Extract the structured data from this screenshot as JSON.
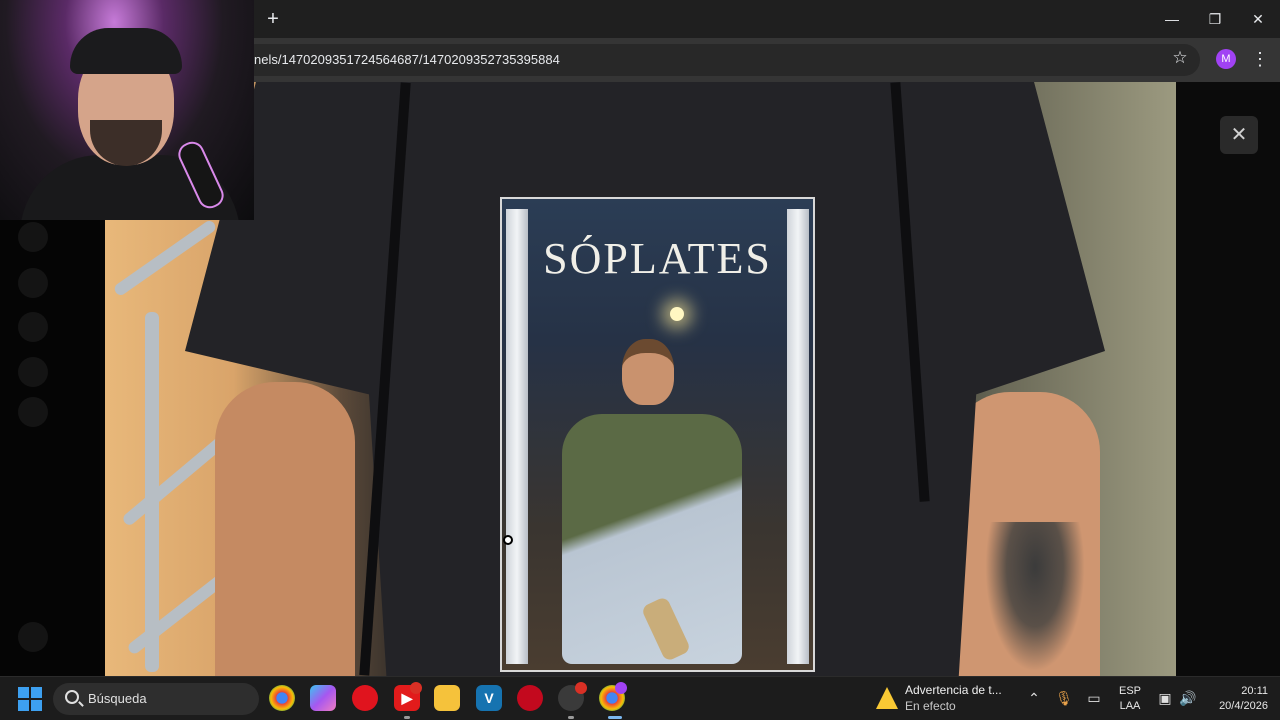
{
  "browser": {
    "new_tab_symbol": "+",
    "url": "nels/1470209351724564687/1470209352735395884",
    "profile_initial": "M",
    "window": {
      "minimize": "—",
      "restore": "❐",
      "close": "✕"
    }
  },
  "viewer": {
    "close_symbol": "✕",
    "image": {
      "print_title": "SÓPLATES"
    }
  },
  "taskbar": {
    "search_placeholder": "Búsqueda",
    "apps": [
      "chrome-icon",
      "copilot-icon",
      "opera-icon",
      "youtube-icon",
      "file-explorer-icon",
      "vegas-icon",
      "opera-gx-icon",
      "obs-icon",
      "chrome-profile-icon"
    ],
    "notification": {
      "title": "Advertencia de t...",
      "subtitle": "En efecto"
    },
    "language": {
      "line1": "ESP",
      "line2": "LAA"
    },
    "clock": {
      "time": "20:11",
      "date": "20/4/2026"
    },
    "colors": {
      "accent": "#3da0f0",
      "warning": "#f9c934",
      "profile": "#a142f4"
    }
  }
}
